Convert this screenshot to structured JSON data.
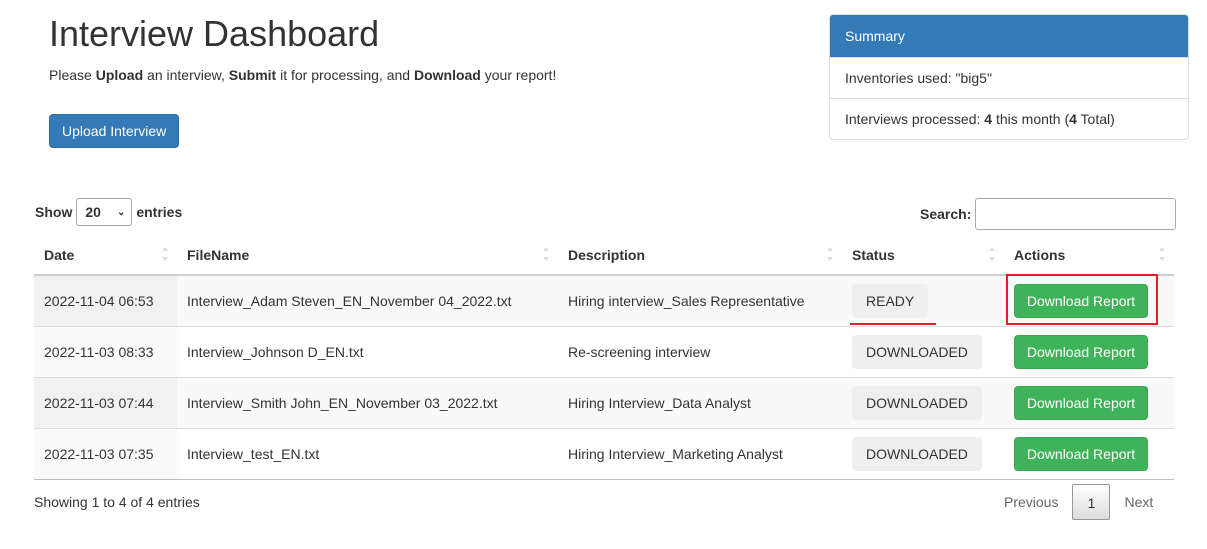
{
  "header": {
    "title": "Interview Dashboard",
    "intro": {
      "t1": "Please ",
      "b1": "Upload",
      "t2": " an interview, ",
      "b2": "Submit",
      "t3": " it for processing, and ",
      "b3": "Download",
      "t4": " your report!"
    },
    "upload_button": "Upload Interview"
  },
  "summary": {
    "title": "Summary",
    "inventories_label": "Inventories used: \"big5\"",
    "processed": {
      "prefix": "Interviews processed: ",
      "month_count": "4",
      "mid": " this month (",
      "total_count": "4",
      "suffix": " Total)"
    }
  },
  "controls": {
    "show_label": "Show",
    "entries_selected": "20",
    "entries_label": "entries",
    "search_label": "Search:",
    "search_value": "",
    "search_placeholder": ""
  },
  "table": {
    "columns": [
      "Date",
      "FileName",
      "Description",
      "Status",
      "Actions"
    ],
    "rows": [
      {
        "date": "2022-11-04 06:53",
        "filename": "Interview_Adam Steven_EN_November 04_2022.txt",
        "description": "Hiring interview_Sales Representative",
        "status": "READY",
        "action": "Download Report"
      },
      {
        "date": "2022-11-03 08:33",
        "filename": "Interview_Johnson D_EN.txt",
        "description": "Re-screening interview",
        "status": "DOWNLOADED",
        "action": "Download Report"
      },
      {
        "date": "2022-11-03 07:44",
        "filename": "Interview_Smith John_EN_November 03_2022.txt",
        "description": "Hiring Interview_Data Analyst",
        "status": "DOWNLOADED",
        "action": "Download Report"
      },
      {
        "date": "2022-11-03 07:35",
        "filename": "Interview_test_EN.txt",
        "description": "Hiring Interview_Marketing Analyst",
        "status": "DOWNLOADED",
        "action": "Download Report"
      }
    ]
  },
  "footer": {
    "info": "Showing 1 to 4 of 4 entries",
    "previous": "Previous",
    "current_page": "1",
    "next": "Next"
  },
  "colors": {
    "primary": "#337ab7",
    "success": "#3fb35a",
    "annotation_red": "#e0202b"
  }
}
